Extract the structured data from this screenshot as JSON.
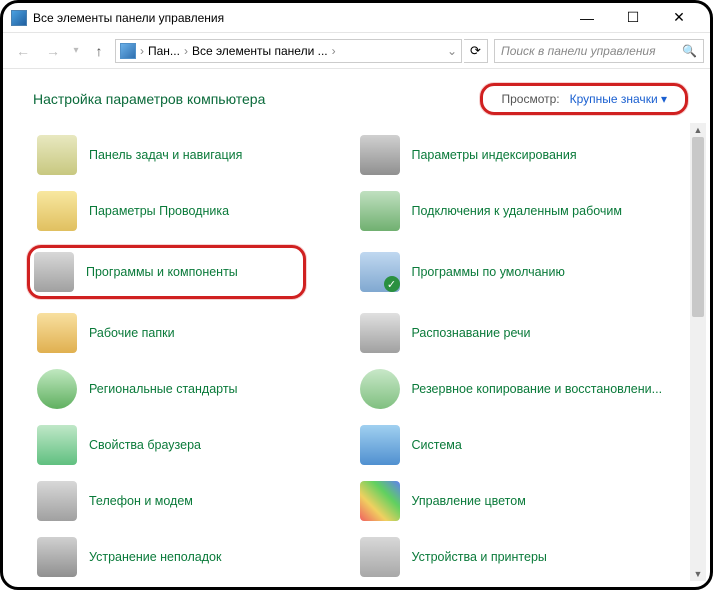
{
  "titlebar": {
    "title": "Все элементы панели управления"
  },
  "navbar": {
    "breadcrumbs": [
      "Пан...",
      "Все элементы панели ..."
    ],
    "search_placeholder": "Поиск в панели управления"
  },
  "header": {
    "heading": "Настройка параметров компьютера",
    "view_label": "Просмотр:",
    "view_value": "Крупные значки"
  },
  "items": [
    {
      "label": "Панель задач и навигация",
      "icon": "taskbar"
    },
    {
      "label": "Параметры индексирования",
      "icon": "index"
    },
    {
      "label": "Параметры Проводника",
      "icon": "explorer"
    },
    {
      "label": "Подключения к удаленным рабочим",
      "icon": "remote"
    },
    {
      "label": "Программы и компоненты",
      "icon": "programs",
      "highlighted": true
    },
    {
      "label": "Программы по умолчанию",
      "icon": "default"
    },
    {
      "label": "Рабочие папки",
      "icon": "folders"
    },
    {
      "label": "Распознавание речи",
      "icon": "speech"
    },
    {
      "label": "Региональные стандарты",
      "icon": "region"
    },
    {
      "label": "Резервное копирование и восстановлени...",
      "icon": "backup"
    },
    {
      "label": "Свойства браузера",
      "icon": "browser"
    },
    {
      "label": "Система",
      "icon": "system"
    },
    {
      "label": "Телефон и модем",
      "icon": "phone"
    },
    {
      "label": "Управление цветом",
      "icon": "color"
    },
    {
      "label": "Устранение неполадок",
      "icon": "troubleshoot"
    },
    {
      "label": "Устройства и принтеры",
      "icon": "devices"
    }
  ]
}
